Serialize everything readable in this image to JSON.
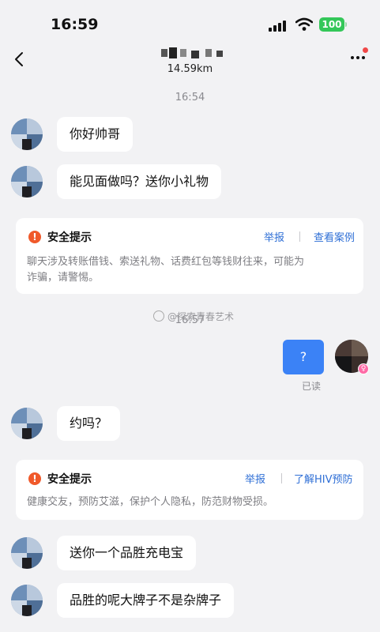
{
  "status_bar": {
    "time": "16:59",
    "battery": "100"
  },
  "header": {
    "distance": "14.59km"
  },
  "messages": [
    {
      "text": "你好帅哥"
    },
    {
      "text": "能见面做吗？送你小礼物"
    },
    {
      "text": "约吗？"
    },
    {
      "text": "送你一个品胜充电宝"
    },
    {
      "text": "品胜的呢大牌子不是杂牌子"
    }
  ],
  "timestamps": [
    "16:54",
    "16:57"
  ],
  "safety_tips": [
    {
      "title": "安全提示",
      "links": [
        "举报",
        "查看案例"
      ],
      "body_lines": [
        "聊天涉及转账借钱、索送礼物、话费红包等钱财往来，可能为",
        "诈骗，请警惕。"
      ]
    },
    {
      "title": "安全提示",
      "links": [
        "举报",
        "了解HIV预防"
      ],
      "body_lines": [
        "健康交友，预防艾滋，保护个人隐私，防范财物受损。"
      ]
    }
  ],
  "my_message": {
    "text": "?",
    "status": "已读"
  },
  "watermark": "@探索青春艺术",
  "colors": {
    "accent": "#3b82f6",
    "link": "#2f6fd6",
    "warning": "#f0592a",
    "battery": "#34c759"
  },
  "icons": {
    "back": "chevron-left-icon",
    "more": "more-dots-icon",
    "warning": "exclamation-icon"
  }
}
